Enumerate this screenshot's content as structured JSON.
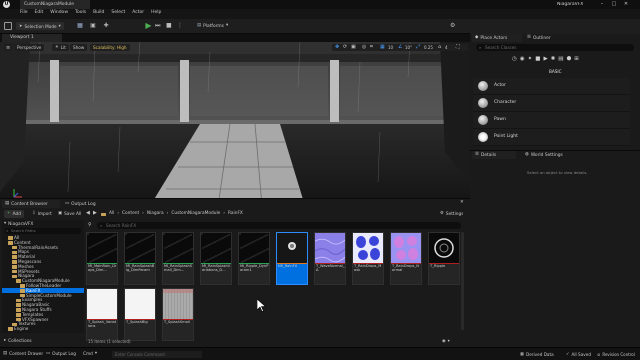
{
  "window": {
    "project": "NiagaraVFX",
    "tab": "CustomNiagaraModule"
  },
  "menu": [
    "File",
    "Edit",
    "Window",
    "Tools",
    "Build",
    "Select",
    "Actor",
    "Help"
  ],
  "toolbar": {
    "mode": "Selection Mode",
    "platforms": "Platforms"
  },
  "viewport": {
    "tab": "Viewport 1",
    "perspective": "Perspective",
    "lit": "Lit",
    "show": "Show",
    "scalability": "Scalability: High",
    "grid": "10",
    "rotation": "10°",
    "scale": "0.25",
    "camera": "4"
  },
  "content_browser": {
    "tab": "Content Browser",
    "output_log_tab": "Output Log",
    "add": "Add",
    "import": "Import",
    "save_all": "Save All",
    "breadcrumb": [
      "All",
      "Content",
      "Niagara",
      "CustomNiagaraModule",
      "RainFX"
    ],
    "settings": "Settings",
    "search_placeholder": "Search RainFX",
    "status": "15 items (1 selected)",
    "tree_search": "Search Paths",
    "tree_root": "NiagaraVFX",
    "tree": [
      "All",
      "Content",
      "ThermalRainAssets",
      "Maps",
      "Material",
      "Megascans",
      "Meshes",
      "MSPresets",
      "Niagara",
      "CustomNiagaraModule",
      "FollowTheLeader",
      "RainFX",
      "SimpleCustomModule",
      "Examples",
      "NiagaraBasic",
      "Niagara Stuffs",
      "Templates",
      "VFXSpawner",
      "Textures",
      "Engine"
    ],
    "collections": "Collections",
    "assets": [
      {
        "label": "MI_MainRain_Drops_Dim...",
        "type": "mi"
      },
      {
        "label": "MI_RainSplashBig_DimParam",
        "type": "mi"
      },
      {
        "label": "MI_RainSplashSmall_Dim...",
        "type": "mi"
      },
      {
        "label": "MI_RainSplashVariations_D...",
        "type": "mi"
      },
      {
        "label": "MI_Ripple_DynParam1",
        "type": "mi"
      },
      {
        "label": "NS_RainFX",
        "type": "ns"
      },
      {
        "label": "T_WaveNormal_A",
        "type": "wave"
      },
      {
        "label": "T_RainDrops_Mask",
        "type": "drops"
      },
      {
        "label": "T_RainDrops_Normal",
        "type": "dropsn"
      },
      {
        "label": "T_Ripple",
        "type": "ripple"
      },
      {
        "label": "T_Splash_Variations",
        "type": "white"
      },
      {
        "label": "T_SplashBig",
        "type": "white"
      },
      {
        "label": "T_SplashSmall",
        "type": "splash"
      }
    ]
  },
  "place_actors": {
    "tab": "Place Actors",
    "outliner_tab": "Outliner",
    "search_placeholder": "Search Classes",
    "category": "BASIC",
    "items": [
      "Actor",
      "Character",
      "Pawn",
      "Point Light"
    ]
  },
  "details": {
    "tab": "Details",
    "world_settings_tab": "World Settings",
    "empty_text": "Select an object to view details."
  },
  "statusbar": {
    "content_drawer": "Content Drawer",
    "output_log": "Output Log",
    "cmd": "Cmd",
    "console_placeholder": "Enter Console Command",
    "derived_data": "Derived Data",
    "save_status": "All Saved",
    "revision_control": "Revision Control"
  }
}
